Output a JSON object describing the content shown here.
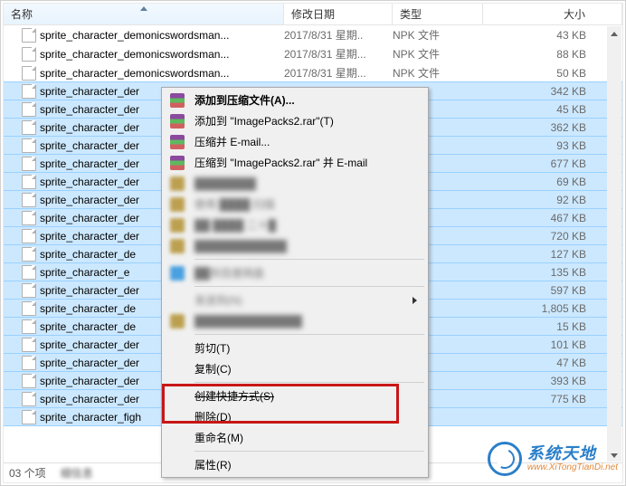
{
  "columns": {
    "name": "名称",
    "date": "修改日期",
    "type": "类型",
    "size": "大小"
  },
  "files": [
    {
      "name": "sprite_character_demonicswordsman...",
      "date": "2017/8/31 星期..",
      "type": "NPK 文件",
      "size": "43 KB"
    },
    {
      "name": "sprite_character_demonicswordsman...",
      "date": "2017/8/31 星期...",
      "type": "NPK 文件",
      "size": "88 KB"
    },
    {
      "name": "sprite_character_demonicswordsman...",
      "date": "2017/8/31 星期...",
      "type": "NPK 文件",
      "size": "50 KB"
    },
    {
      "name": "sprite_character_der",
      "date": "",
      "type": "",
      "size": "342 KB"
    },
    {
      "name": "sprite_character_der",
      "date": "",
      "type": "",
      "size": "45 KB"
    },
    {
      "name": "sprite_character_der",
      "date": "",
      "type": "",
      "size": "362 KB"
    },
    {
      "name": "sprite_character_der",
      "date": "",
      "type": "",
      "size": "93 KB"
    },
    {
      "name": "sprite_character_der",
      "date": "",
      "type": "",
      "size": "677 KB"
    },
    {
      "name": "sprite_character_der",
      "date": "",
      "type": "",
      "size": "69 KB"
    },
    {
      "name": "sprite_character_der",
      "date": "",
      "type": "",
      "size": "92 KB"
    },
    {
      "name": "sprite_character_der",
      "date": "",
      "type": "",
      "size": "467 KB"
    },
    {
      "name": "sprite_character_der",
      "date": "",
      "type": "",
      "size": "720 KB"
    },
    {
      "name": "sprite_character_de",
      "date": "",
      "type": "",
      "size": "127 KB"
    },
    {
      "name": "sprite_character_e",
      "date": "",
      "type": "",
      "size": "135 KB"
    },
    {
      "name": "sprite_character_der",
      "date": "",
      "type": "",
      "size": "597 KB"
    },
    {
      "name": "sprite_character_de",
      "date": "",
      "type": "",
      "size": "1,805 KB"
    },
    {
      "name": "sprite_character_de",
      "date": "",
      "type": "",
      "size": "15 KB"
    },
    {
      "name": "sprite_character_der",
      "date": "",
      "type": "",
      "size": "101 KB"
    },
    {
      "name": "sprite_character_der",
      "date": "",
      "type": "",
      "size": "47 KB"
    },
    {
      "name": "sprite_character_der",
      "date": "",
      "type": "",
      "size": "393 KB"
    },
    {
      "name": "sprite_character_der",
      "date": "",
      "type": "",
      "size": "775 KB"
    },
    {
      "name": "sprite_character_figh",
      "date": "",
      "type": "",
      "size": ""
    }
  ],
  "selected_start": 3,
  "context_menu": [
    {
      "label": "添加到压缩文件(A)...",
      "icon": "winrar",
      "bold": true
    },
    {
      "label": "添加到 \"ImagePacks2.rar\"(T)",
      "icon": "winrar"
    },
    {
      "label": "压缩并 E-mail...",
      "icon": "winrar"
    },
    {
      "label": "压缩到 \"ImagePacks2.rar\" 并 E-mail",
      "icon": "winrar"
    },
    {
      "label": "████████",
      "icon": "blur",
      "blur": true
    },
    {
      "label": "使用 ████ 扫描",
      "icon": "blur",
      "blur": true
    },
    {
      "label": "██ ████ 二十█",
      "icon": "blur",
      "blur": true
    },
    {
      "label": "████████████",
      "icon": "blur",
      "blur": true
    },
    {
      "sep": true
    },
    {
      "label": "██到百度网盘",
      "icon": "blue",
      "blur": true
    },
    {
      "sep": true
    },
    {
      "label": "发送到(N)",
      "blur": true,
      "sub": true
    },
    {
      "label": "██████████████",
      "icon": "blur",
      "blur": true
    },
    {
      "sep": true
    },
    {
      "label": "剪切(T)"
    },
    {
      "label": "复制(C)"
    },
    {
      "sep": true
    },
    {
      "label": "创建快捷方式(S)",
      "strike": true
    },
    {
      "label": "删除(D)"
    },
    {
      "label": "重命名(M)"
    },
    {
      "sep": true
    },
    {
      "label": "属性(R)"
    }
  ],
  "status": {
    "count": "03 个项",
    "detail": "细信息"
  },
  "watermark": {
    "cn": "系统天地",
    "en": "www.XiTongTianDi.net"
  }
}
